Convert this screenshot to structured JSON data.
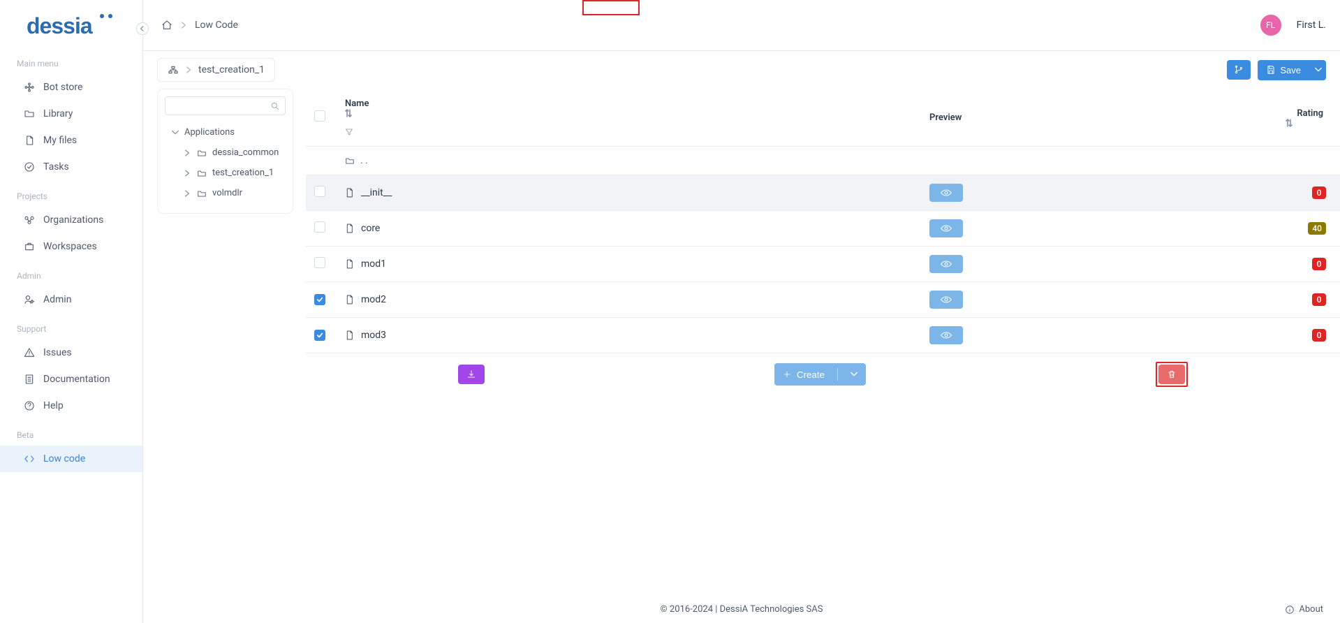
{
  "header": {
    "home_label": "",
    "breadcrumb_current": "Low Code",
    "user_initials": "FL",
    "user_name": "First L."
  },
  "sidebar": {
    "logo_text": "dessia",
    "sections": [
      {
        "label": "Main menu",
        "items": [
          {
            "key": "bot-store",
            "label": "Bot store",
            "icon": "bot"
          },
          {
            "key": "library",
            "label": "Library",
            "icon": "folder"
          },
          {
            "key": "my-files",
            "label": "My files",
            "icon": "file"
          },
          {
            "key": "tasks",
            "label": "Tasks",
            "icon": "check-circle"
          }
        ]
      },
      {
        "label": "Projects",
        "items": [
          {
            "key": "organizations",
            "label": "Organizations",
            "icon": "org"
          },
          {
            "key": "workspaces",
            "label": "Workspaces",
            "icon": "briefcase"
          }
        ]
      },
      {
        "label": "Admin",
        "items": [
          {
            "key": "admin",
            "label": "Admin",
            "icon": "user-gear"
          }
        ]
      },
      {
        "label": "Support",
        "items": [
          {
            "key": "issues",
            "label": "Issues",
            "icon": "warning"
          },
          {
            "key": "documentation",
            "label": "Documentation",
            "icon": "doc"
          },
          {
            "key": "help",
            "label": "Help",
            "icon": "question"
          }
        ]
      },
      {
        "label": "Beta",
        "items": [
          {
            "key": "low-code",
            "label": "Low code",
            "icon": "code",
            "active": true
          }
        ]
      }
    ]
  },
  "page_toolbar": {
    "breadcrumb_icon": "sitemap",
    "breadcrumb_label": "test_creation_1",
    "branch_btn": "",
    "save_btn": "Save"
  },
  "tree": {
    "search_placeholder": "",
    "root_label": "Applications",
    "children": [
      {
        "label": "dessia_common"
      },
      {
        "label": "test_creation_1"
      },
      {
        "label": "volmdlr"
      }
    ]
  },
  "table": {
    "columns": {
      "name": "Name",
      "preview": "Preview",
      "rating": "Rating"
    },
    "parent_label": ". .",
    "rows": [
      {
        "name": "__init__",
        "checked": false,
        "rating": "0",
        "rating_color": "red",
        "hover": true
      },
      {
        "name": "core",
        "checked": false,
        "rating": "40",
        "rating_color": "olive"
      },
      {
        "name": "mod1",
        "checked": false,
        "rating": "0",
        "rating_color": "red"
      },
      {
        "name": "mod2",
        "checked": true,
        "rating": "0",
        "rating_color": "red"
      },
      {
        "name": "mod3",
        "checked": true,
        "rating": "0",
        "rating_color": "red"
      }
    ]
  },
  "actions": {
    "create_label": "Create"
  },
  "footer": {
    "copyright": "© 2016-2024 | DessiA Technologies SAS",
    "about_label": "About"
  }
}
